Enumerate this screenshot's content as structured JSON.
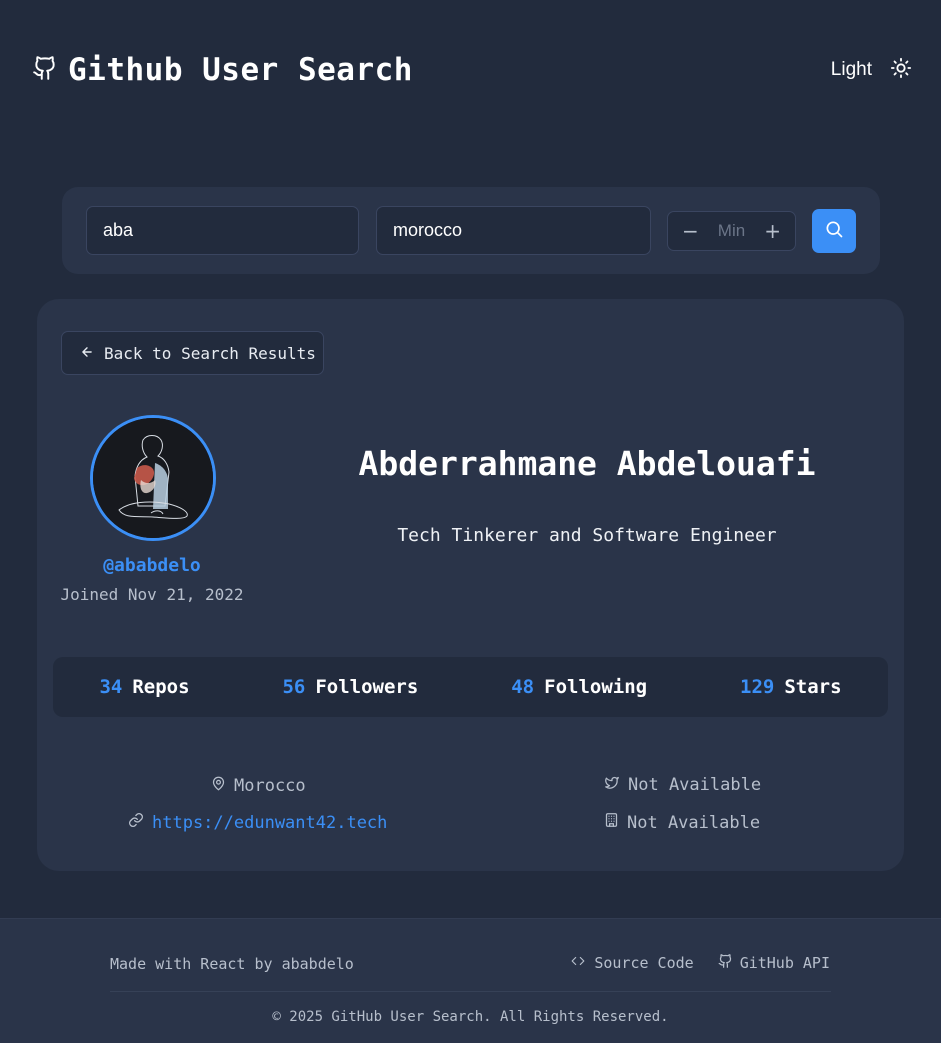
{
  "header": {
    "title": "Github User Search",
    "theme_label": "Light",
    "icons": {
      "logo": "github-icon",
      "theme": "sun-icon"
    }
  },
  "search": {
    "username_value": "aba",
    "location_value": "morocco",
    "min_placeholder": "Min",
    "minus_label": "−",
    "plus_label": "+",
    "search_icon": "search-icon"
  },
  "profile": {
    "back_label": "Back to Search Results",
    "login": "@ababdelo",
    "joined": "Joined Nov 21, 2022",
    "name": "Abderrahmane Abdelouafi",
    "bio": "Tech Tinkerer and Software Engineer",
    "stats": [
      {
        "value": "34",
        "label": "Repos"
      },
      {
        "value": "56",
        "label": "Followers"
      },
      {
        "value": "48",
        "label": "Following"
      },
      {
        "value": "129",
        "label": "Stars"
      }
    ],
    "location": "Morocco",
    "website": "https://edunwant42.tech",
    "twitter": "Not Available",
    "company": "Not Available"
  },
  "footer": {
    "made_with": "Made with React by",
    "author": "ababdelo",
    "source_code": "Source Code",
    "github_api": "GitHub API",
    "copyright": "© 2025 GitHub User Search. All Rights Reserved."
  },
  "colors": {
    "background": "#222b3d",
    "card": "#2a3449",
    "accent": "#3b8ff6",
    "muted_text": "#b7bfcc"
  }
}
